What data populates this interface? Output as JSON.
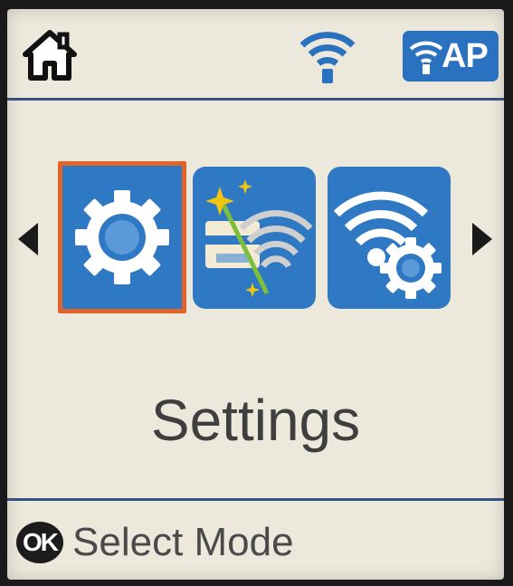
{
  "status_bar": {
    "home_icon": "home-icon",
    "wifi_icon": "wifi-signal-icon",
    "ap_badge_label": "AP",
    "ap_badge_color": "#2a72c0"
  },
  "carousel": {
    "selected_index": 0,
    "items": [
      {
        "icon": "settings-gear-icon"
      },
      {
        "icon": "wifi-setup-wizard-icon"
      },
      {
        "icon": "network-settings-icon"
      }
    ],
    "selected_label": "Settings",
    "highlight_color": "#e2632a",
    "tile_color": "#2f78c4"
  },
  "footer": {
    "ok_label": "OK",
    "hint": "Select Mode"
  }
}
